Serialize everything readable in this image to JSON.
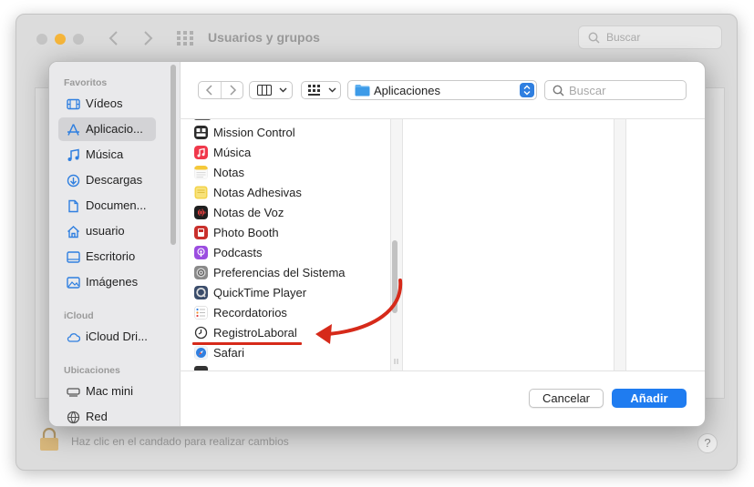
{
  "background_window": {
    "title": "Usuarios y grupos",
    "search_placeholder": "Buscar",
    "lock_text": "Haz clic en el candado para realizar cambios",
    "help_label": "?"
  },
  "dialog": {
    "sidebar": {
      "sections": [
        {
          "title": "Favoritos",
          "items": [
            {
              "label": "Vídeos",
              "icon": "film-icon"
            },
            {
              "label": "Aplicacio...",
              "icon": "apps-icon",
              "selected": true
            },
            {
              "label": "Música",
              "icon": "music-note-icon"
            },
            {
              "label": "Descargas",
              "icon": "download-icon"
            },
            {
              "label": "Documen...",
              "icon": "document-icon"
            },
            {
              "label": "usuario",
              "icon": "home-icon"
            },
            {
              "label": "Escritorio",
              "icon": "desktop-icon"
            },
            {
              "label": "Imágenes",
              "icon": "photo-icon"
            }
          ]
        },
        {
          "title": "iCloud",
          "items": [
            {
              "label": "iCloud Dri...",
              "icon": "cloud-icon"
            }
          ]
        },
        {
          "title": "Ubicaciones",
          "items": [
            {
              "label": "Mac mini",
              "icon": "computer-icon"
            },
            {
              "label": "Red",
              "icon": "globe-icon"
            }
          ]
        }
      ]
    },
    "toolbar": {
      "location": "Aplicaciones",
      "search_placeholder": "Buscar"
    },
    "files": [
      {
        "name": "Mission Control",
        "color": "#2b2b2b"
      },
      {
        "name": "Música",
        "color": "#f0384b"
      },
      {
        "name": "Notas",
        "color": "#f5c93a"
      },
      {
        "name": "Notas Adhesivas",
        "color": "#f3d34a"
      },
      {
        "name": "Notas de Voz",
        "color": "#1f1f1f"
      },
      {
        "name": "Photo Booth",
        "color": "#c9302c"
      },
      {
        "name": "Podcasts",
        "color": "#9b4de0"
      },
      {
        "name": "Preferencias del Sistema",
        "color": "#8a8a8a"
      },
      {
        "name": "QuickTime Player",
        "color": "#3b4d6b"
      },
      {
        "name": "Recordatorios",
        "color": "#ffffff"
      },
      {
        "name": "RegistroLaboral",
        "color": "#ffffff"
      },
      {
        "name": "Safari",
        "color": "#2f7fe0"
      }
    ],
    "buttons": {
      "cancel": "Cancelar",
      "add": "Añadir"
    }
  },
  "colors": {
    "accent": "#1f7cf0",
    "annotation": "#d62a1a"
  }
}
